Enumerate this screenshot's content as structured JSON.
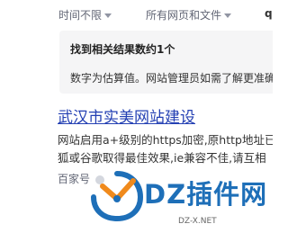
{
  "filters": {
    "time_label": "时间不限",
    "site_label": "所有网页和文件",
    "query_fragment": "q"
  },
  "notice": {
    "title": "找到相关结果数约1个",
    "description": "数字为估算值。网站管理员如需了解更准确"
  },
  "result": {
    "title": "武汉市实美网站建设",
    "snippet_line1": "网站启用a+级别的https加密,原http地址已",
    "snippet_line2": "狐或谷歌取得最佳效果,ie兼容不佳,请互相",
    "source": "百家号"
  },
  "watermark": {
    "text": "DZ插件网",
    "domain": "DZ-X.NET"
  },
  "colors": {
    "link": "#2440b3",
    "notice_bg": "#f5f5f6",
    "watermark_blue": "#1e6fb8",
    "watermark_orange": "#f08a1c"
  }
}
